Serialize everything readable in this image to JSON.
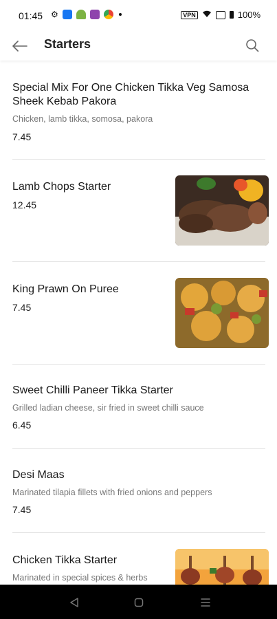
{
  "status_bar": {
    "time": "01:45",
    "battery": "100%"
  },
  "app_bar": {
    "title": "Starters"
  },
  "items": [
    {
      "name": "Special Mix For One Chicken Tikka Veg Samosa Sheek Kebab Pakora",
      "description": "Chicken, lamb tikka, somosa, pakora",
      "price": "7.45"
    },
    {
      "name": "Lamb Chops Starter",
      "description": "",
      "price": "12.45"
    },
    {
      "name": "King Prawn On Puree",
      "description": "",
      "price": "7.45"
    },
    {
      "name": "Sweet Chilli Paneer Tikka Starter",
      "description": "Grilled ladian cheese, sir fried in sweet chilli sauce",
      "price": "6.45"
    },
    {
      "name": "Desi Maas",
      "description": "Marinated tilapia fillets with fried onions and peppers",
      "price": "7.45"
    },
    {
      "name": "Chicken Tikka Starter",
      "description": "Marinated in special spices & herbs",
      "price": ""
    }
  ],
  "icons": {
    "back": "arrow-left-icon",
    "search": "search-icon"
  }
}
